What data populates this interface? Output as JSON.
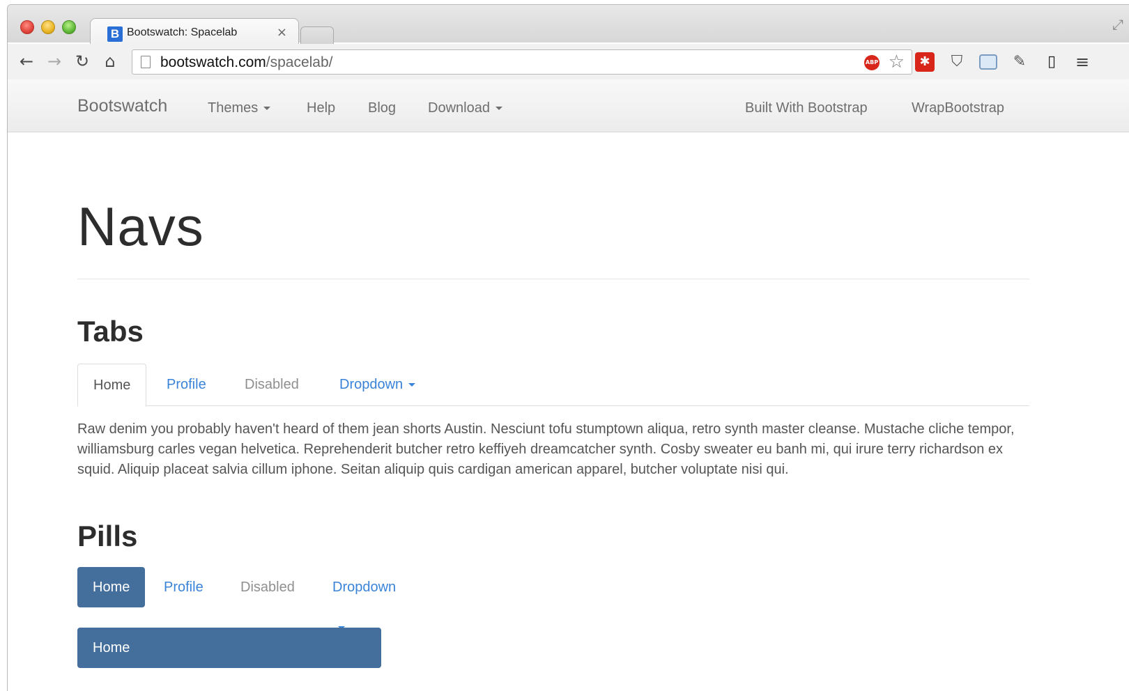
{
  "browser": {
    "tab_title": "Bootswatch: Spacelab",
    "tab_close": "×",
    "favicon_letter": "B",
    "url_host": "bootswatch.com",
    "url_path": "/spacelab/"
  },
  "navbar": {
    "brand": "Bootswatch",
    "links": [
      "Themes",
      "Help",
      "Blog",
      "Download"
    ],
    "right_links": [
      "Built With Bootstrap",
      "WrapBootstrap"
    ]
  },
  "content": {
    "page_title": "Navs",
    "tabs_heading": "Tabs",
    "tabs": [
      "Home",
      "Profile",
      "Disabled",
      "Dropdown"
    ],
    "paragraph": "Raw denim you probably haven't heard of them jean shorts Austin. Nesciunt tofu stumptown aliqua, retro synth master cleanse. Mustache cliche tempor, williamsburg carles vegan helvetica. Reprehenderit butcher retro keffiyeh dreamcatcher synth. Cosby sweater eu banh mi, qui irure terry richardson ex squid. Aliquip placeat salvia cillum iphone. Seitan aliquip quis cardigan american apparel, butcher voluptate nisi qui.",
    "pills_heading": "Pills",
    "pills": [
      "Home",
      "Profile",
      "Disabled",
      "Dropdown"
    ],
    "stacked_pill": "Home"
  },
  "colors": {
    "accent": "#446e9b",
    "link": "#3983d8",
    "muted": "#8f8f8f"
  }
}
